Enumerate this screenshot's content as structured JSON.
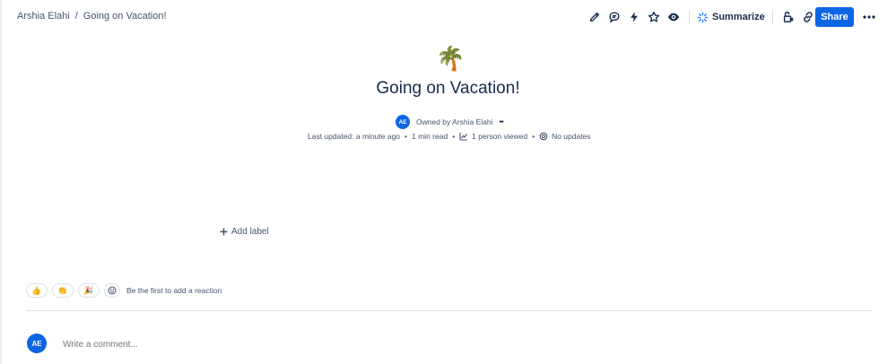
{
  "breadcrumb": {
    "space": "Arshia Elahi",
    "separator": "/",
    "page": "Going on Vacation!"
  },
  "toolbar": {
    "icons": [
      "edit-icon",
      "comment-icon",
      "automation-icon",
      "star-icon",
      "watch-icon"
    ],
    "summarize_label": "Summarize",
    "share_label": "Share"
  },
  "page": {
    "emoji": "🌴",
    "title": "Going on Vacation!"
  },
  "byline": {
    "avatar_initials": "AE",
    "owner_text": "Owned by Arshia Elahi",
    "more": "•••"
  },
  "meta": {
    "last_updated": "Last updated: a minute ago",
    "read_time": "1 min read",
    "viewers": "1 person viewed",
    "updates": "No updates"
  },
  "labels": {
    "add_label": "Add label"
  },
  "reactions": {
    "items": [
      "👍",
      "👏",
      "🎉"
    ],
    "hint": "Be the first to add a reaction"
  },
  "comment": {
    "avatar_initials": "AE",
    "placeholder": "Write a comment..."
  },
  "colors": {
    "brand_blue": "#0c66e4",
    "text": "#172b4d",
    "subtle_text": "#44546f"
  }
}
